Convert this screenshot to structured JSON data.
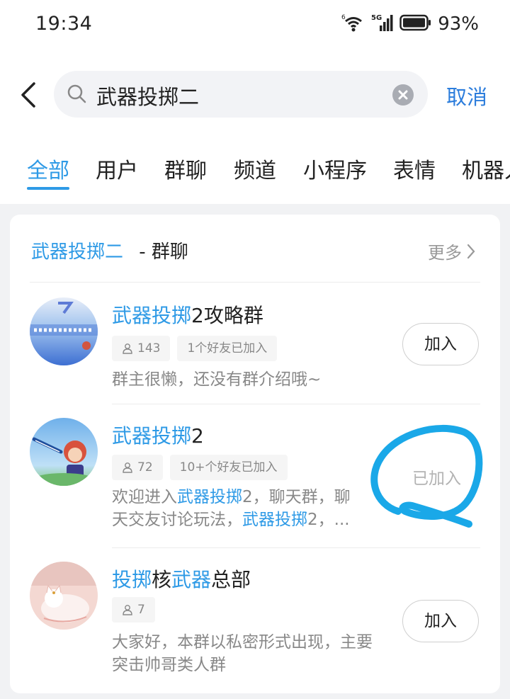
{
  "status_bar": {
    "time": "19:34",
    "battery": "93%",
    "network": "5G",
    "wifi_badge": "6"
  },
  "search": {
    "query": "武器投掷二",
    "cancel_label": "取消"
  },
  "tabs": [
    {
      "label": "全部",
      "active": true
    },
    {
      "label": "用户"
    },
    {
      "label": "群聊"
    },
    {
      "label": "频道"
    },
    {
      "label": "小程序"
    },
    {
      "label": "表情"
    },
    {
      "label": "机器人"
    }
  ],
  "section": {
    "keyword": "武器投掷二",
    "suffix": "- 群聊",
    "more_label": "更多"
  },
  "groups": [
    {
      "name_hl": "武器投掷",
      "name_rest": "2攻略群",
      "members": "143",
      "friends": "1个好友已加入",
      "desc": "群主很懒，还没有群介绍哦~",
      "action": "加入"
    },
    {
      "name_hl": "武器投掷",
      "name_rest": "2",
      "members": "72",
      "friends": "10+个好友已加入",
      "desc_parts": [
        "欢迎进入",
        "武器投掷",
        "2，聊天群，聊",
        "天交友讨论玩法，",
        "武器投掷",
        "2，..."
      ],
      "action": "已加入"
    },
    {
      "name_parts": [
        "投掷",
        "核",
        "武器",
        "总部"
      ],
      "members": "7",
      "desc": "大家好，本群以私密形式出现，主要突击帅哥类人群",
      "action": "加入"
    }
  ],
  "colors": {
    "accent": "#2e9ae6",
    "cancel": "#2c7ddc",
    "annotation": "#1aa8e8"
  }
}
